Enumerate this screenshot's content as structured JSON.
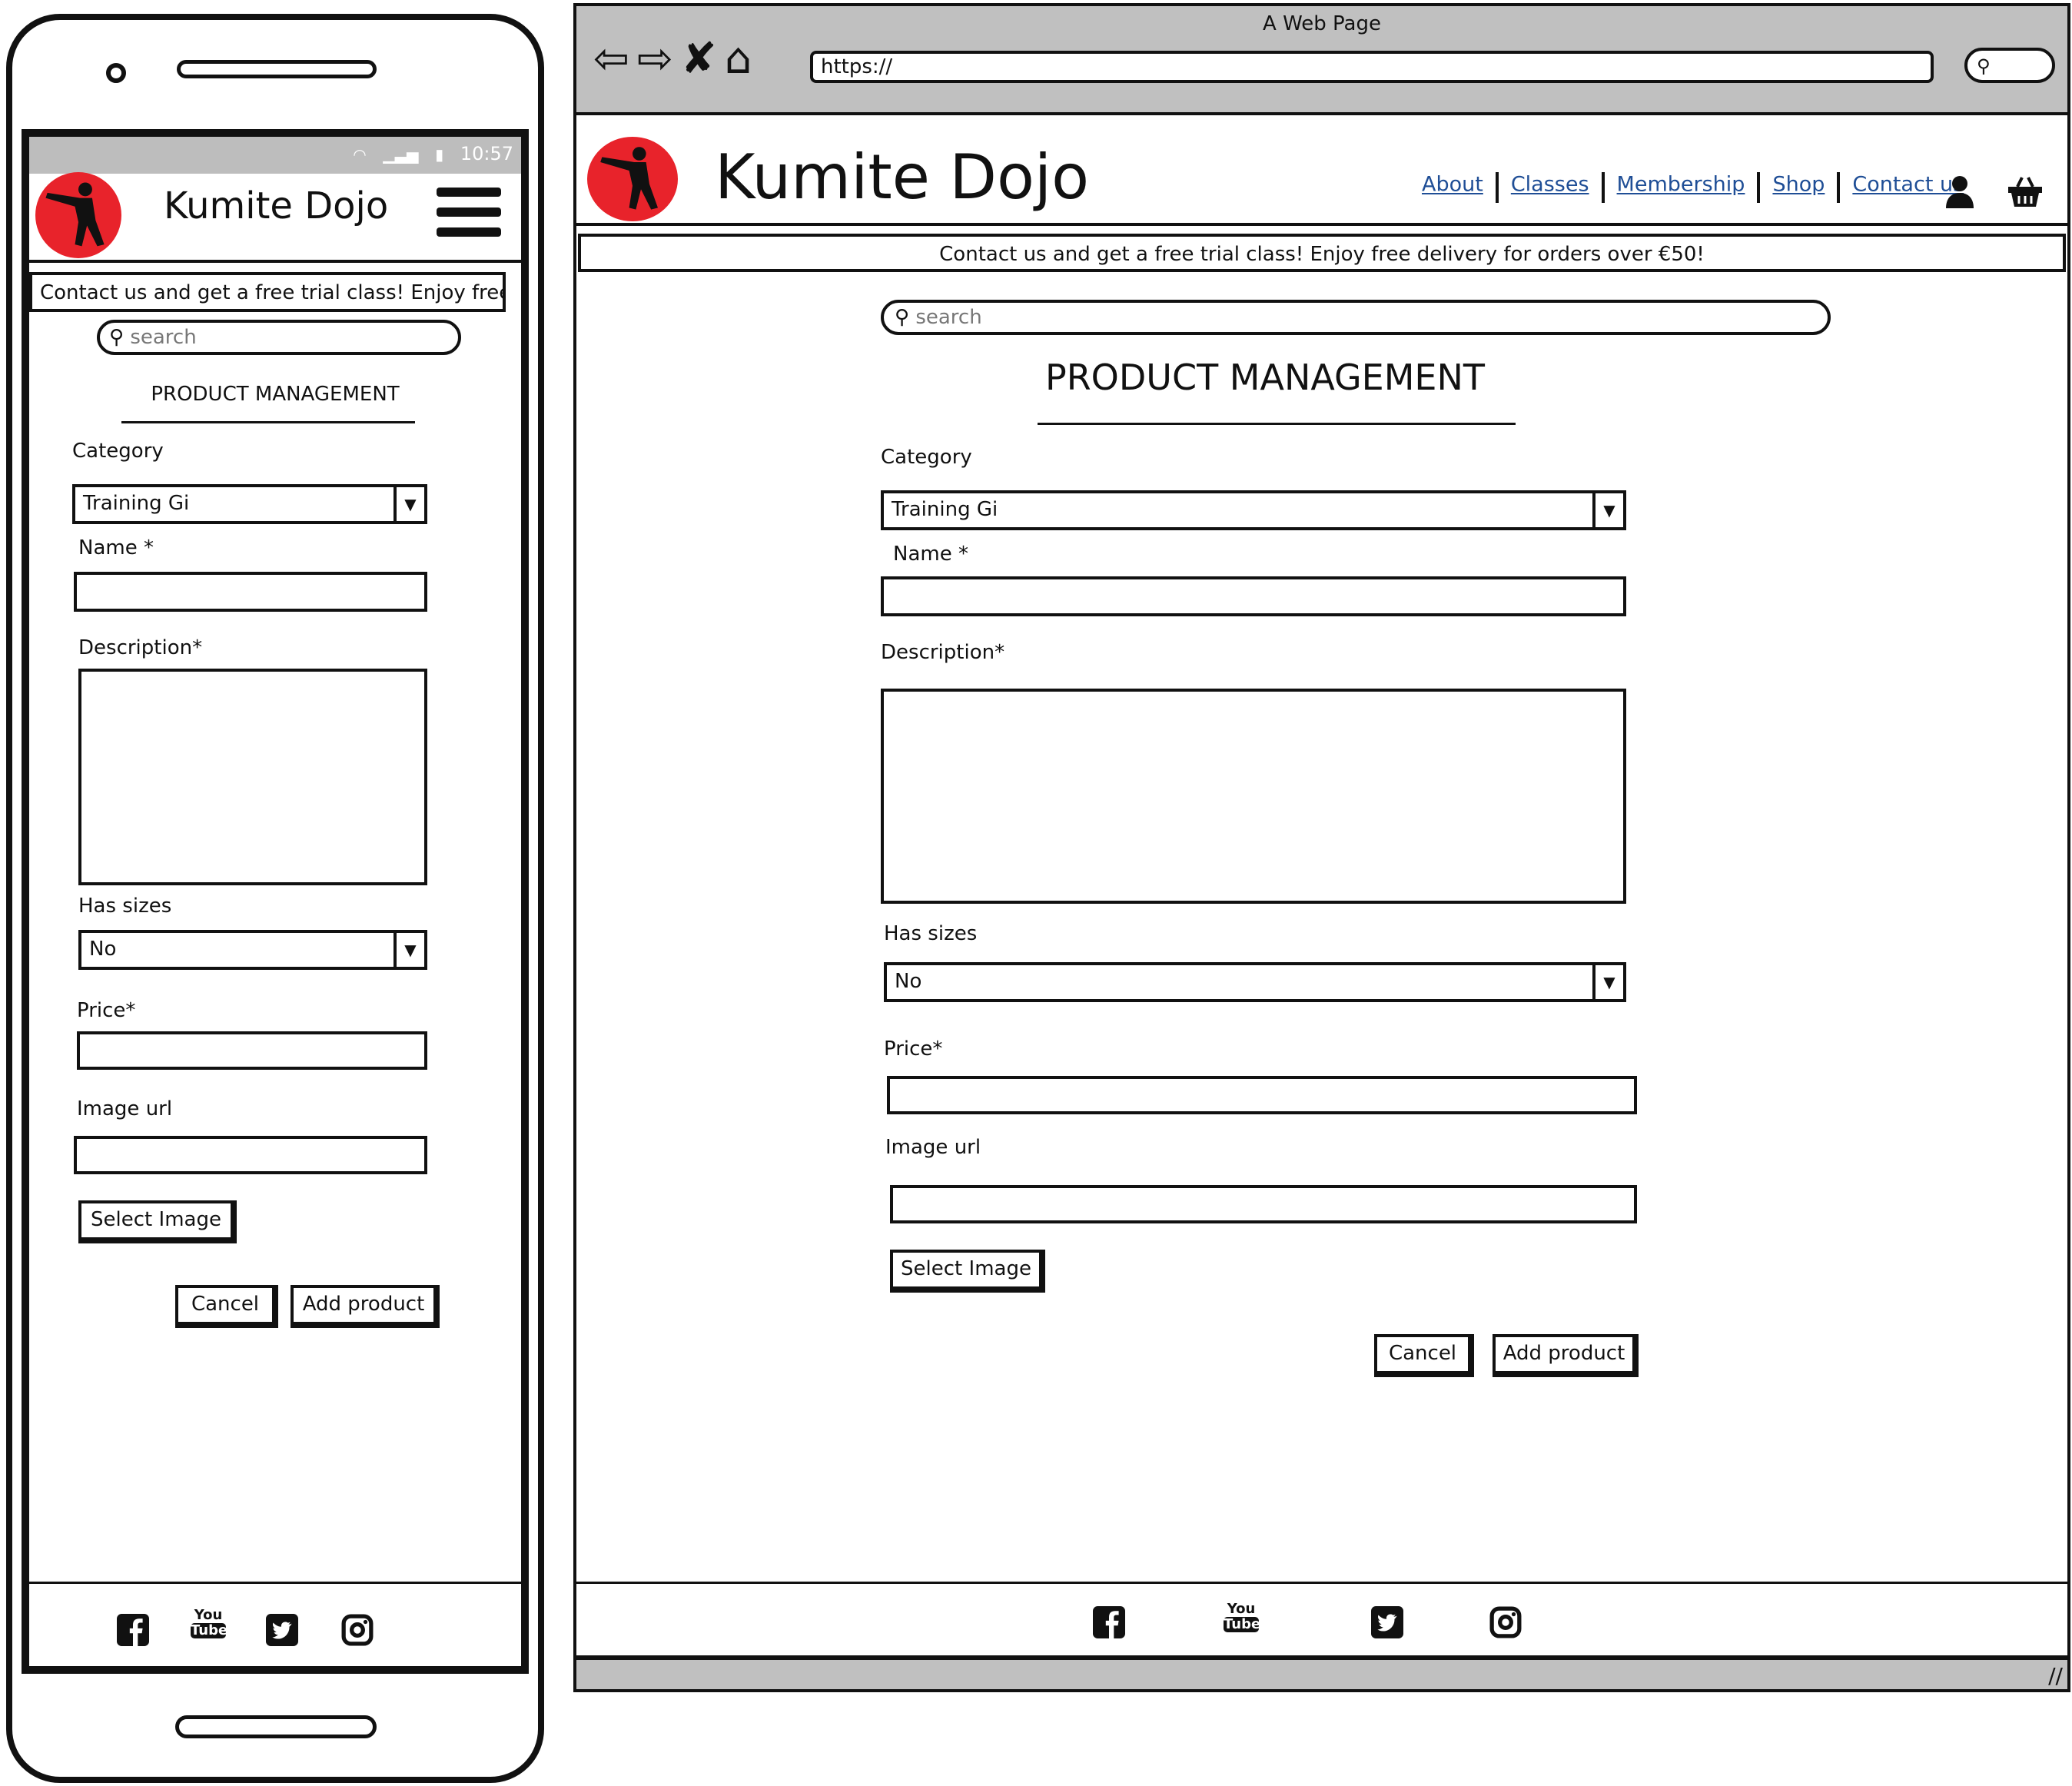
{
  "brand": {
    "name": "Kumite Dojo",
    "logo_color": "#e8232b"
  },
  "phone": {
    "status_time": "10:57"
  },
  "browser": {
    "window_title": "A Web Page",
    "url": "https://"
  },
  "nav": {
    "links": [
      {
        "label": "About"
      },
      {
        "label": "Classes"
      },
      {
        "label": "Membership"
      },
      {
        "label": "Shop"
      },
      {
        "label": "Contact us"
      }
    ],
    "account_icon": "user-icon",
    "cart_icon": "basket-icon",
    "link_color": "#1f4e96"
  },
  "banner": {
    "text": "Contact us and get a free trial class! Enjoy free delivery for orders over €50!",
    "text_mobile": "Contact us and get a free trial class! Enjoy free del"
  },
  "search": {
    "placeholder": "search"
  },
  "page": {
    "title": "PRODUCT MANAGEMENT"
  },
  "form": {
    "category_label": "Category",
    "category_value": "Training Gi",
    "name_label": "Name *",
    "name_value": "",
    "description_label": "Description*",
    "description_value": "",
    "has_sizes_label": "Has sizes",
    "has_sizes_value": "No",
    "price_label": "Price*",
    "price_value": "",
    "image_url_label": "Image url",
    "image_url_value": "",
    "select_image_label": "Select Image",
    "cancel_label": "Cancel",
    "add_product_label": "Add product"
  },
  "footer": {
    "icons": [
      "facebook-icon",
      "youtube-icon",
      "twitter-icon",
      "instagram-icon"
    ],
    "youtube_text_top": "You",
    "youtube_text_bottom": "Tube"
  }
}
